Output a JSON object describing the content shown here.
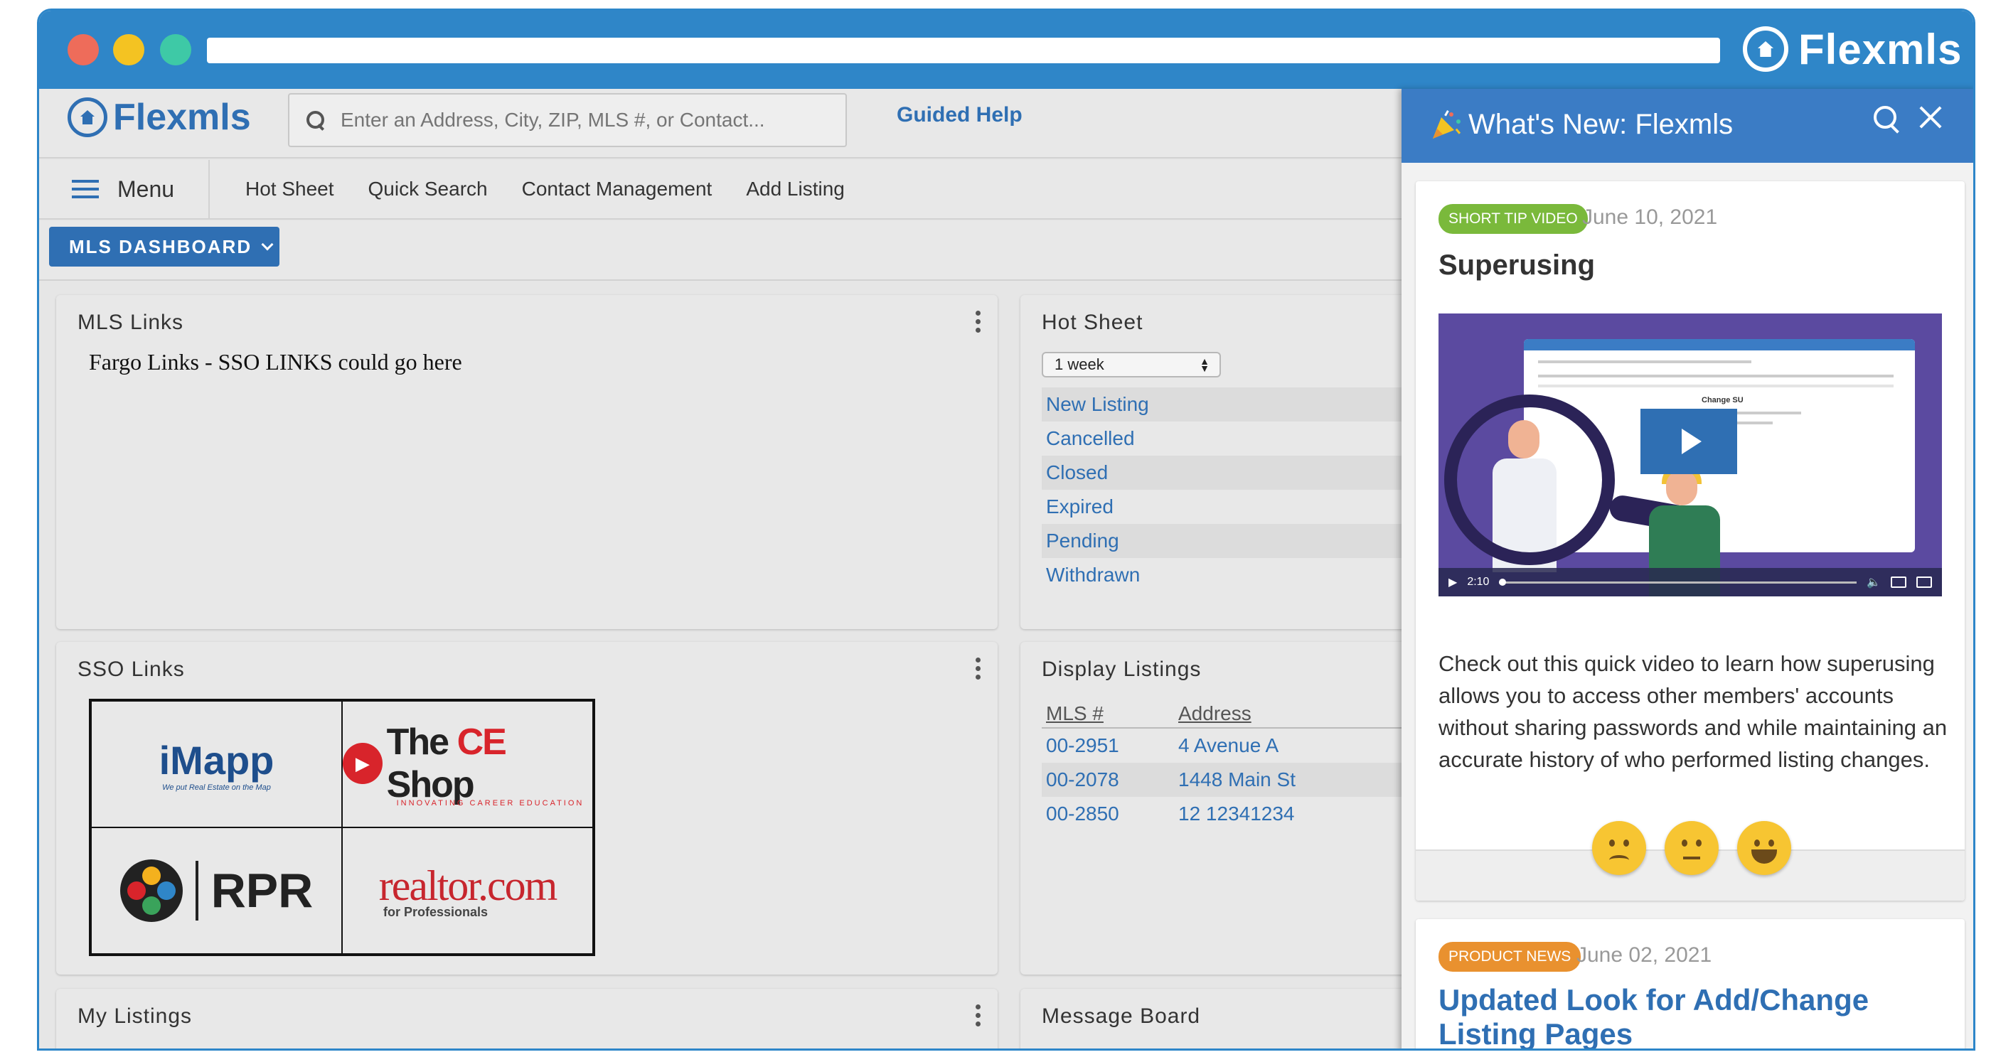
{
  "browser": {
    "brand": "Flexmls"
  },
  "app": {
    "brand": "Flexmls",
    "search_placeholder": "Enter an Address, City, ZIP, MLS #, or Contact...",
    "guided_help": "Guided Help"
  },
  "nav": {
    "menu_label": "Menu",
    "items": [
      "Hot Sheet",
      "Quick Search",
      "Contact Management",
      "Add Listing"
    ]
  },
  "dashboard": {
    "button_label": "MLS DASHBOARD"
  },
  "mls_links": {
    "title": "MLS Links",
    "text": "Fargo Links - SSO LINKS could go here"
  },
  "sso_links": {
    "title": "SSO Links",
    "imapp": {
      "name": "iMapp",
      "tagline": "We put Real Estate on the Map"
    },
    "ce_shop": {
      "name_a": "The ",
      "name_b": "CE",
      "name_c": " Shop",
      "tagline": "INNOVATING CAREER EDUCATION"
    },
    "rpr": {
      "name": "RPR"
    },
    "realtor": {
      "name": "realtor.com",
      "sub": "for Professionals"
    }
  },
  "my_listings": {
    "title": "My Listings"
  },
  "hot_sheet": {
    "title": "Hot Sheet",
    "selected_period": "1 week",
    "items": [
      "New Listing",
      "Cancelled",
      "Closed",
      "Expired",
      "Pending",
      "Withdrawn"
    ]
  },
  "display_listings": {
    "title": "Display Listings",
    "columns": [
      "MLS #",
      "Address"
    ],
    "rows": [
      {
        "mls": "00-2951",
        "address": "4 Avenue A"
      },
      {
        "mls": "00-2078",
        "address": "1448 Main St"
      },
      {
        "mls": "00-2850",
        "address": "12 12341234"
      }
    ]
  },
  "message_board": {
    "title": "Message Board"
  },
  "whats_new": {
    "title": "What's New: Flexmls",
    "cards": [
      {
        "badge": "SHORT TIP VIDEO",
        "date": "June 10, 2021",
        "title": "Superusing",
        "video": {
          "time": "2:10",
          "screen_title": "Change SU"
        },
        "body": "Check out this quick video to learn how superusing allows you to access other members' accounts without sharing passwords and while maintaining an accurate history of who performed listing changes."
      },
      {
        "badge": "PRODUCT NEWS",
        "date": "June 02, 2021",
        "title": "Updated Look for Add/Change Listing Pages"
      }
    ]
  },
  "colors": {
    "browser_bar": "#2f86c8",
    "brand_blue": "#2f6fb3",
    "badge_green": "#7ab93b",
    "badge_orange": "#e9912f",
    "emoji_yellow": "#f7c532"
  }
}
